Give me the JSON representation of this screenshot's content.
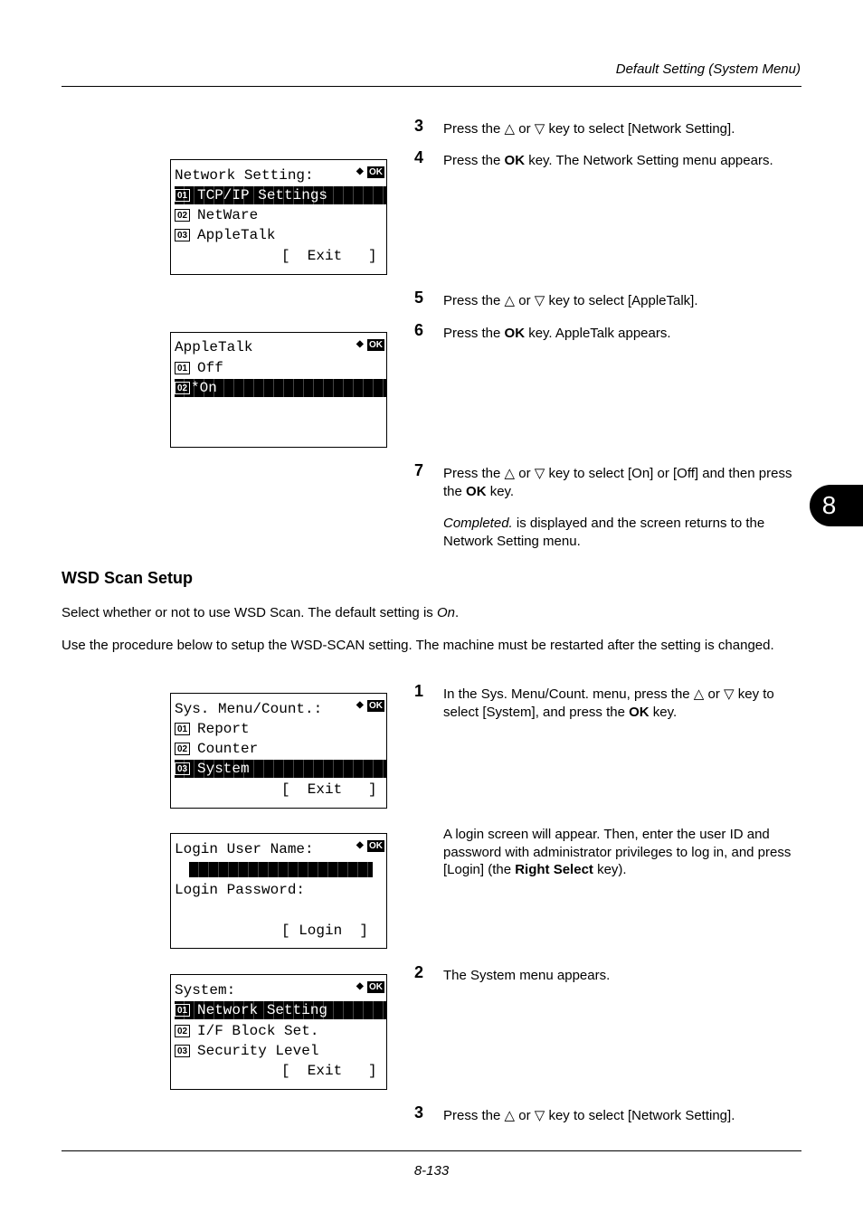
{
  "header": {
    "title": "Default Setting (System Menu)"
  },
  "chapter_tab": "8",
  "footer": {
    "page_number": "8-133"
  },
  "steps_top": [
    {
      "num": "3",
      "text": "Press the △ or ▽ key to select [Network Setting]."
    },
    {
      "num": "4",
      "text_before": "Press the ",
      "bold": "OK",
      "text_after": " key. The Network Setting menu appears."
    },
    {
      "num": "5",
      "text": "Press the △ or ▽ key to select [AppleTalk]."
    },
    {
      "num": "6",
      "text_before": "Press the ",
      "bold": "OK",
      "text_after": " key. AppleTalk appears."
    },
    {
      "num": "7",
      "text_before": "Press the △ or ▽ key to select [On] or [Off] and then press the ",
      "bold": "OK",
      "text_after": " key.",
      "note_italic": "Completed.",
      "note_rest": " is displayed and the screen returns to the Network Setting menu."
    }
  ],
  "section": {
    "title": "WSD Scan Setup",
    "intro_before": "Select whether or not to use WSD Scan. The default setting is ",
    "intro_italic": "On",
    "intro_after": ".",
    "procedure": "Use the procedure below to setup the WSD-SCAN setting. The machine must be restarted after the setting is changed."
  },
  "steps_bottom": [
    {
      "num": "1",
      "text_before": "In the Sys. Menu/Count. menu, press the △ or ▽ key to select [System], and press the ",
      "bold": "OK",
      "text_after": " key."
    },
    {
      "num": "",
      "text_before": "A login screen will appear. Then, enter the user ID and password with administrator privileges to log in, and press [Login] (the ",
      "bold": "Right Select",
      "text_after": " key)."
    },
    {
      "num": "2",
      "text": "The System menu appears."
    },
    {
      "num": "3",
      "text": "Press the △ or ▽ key to select [Network Setting]."
    }
  ],
  "icons": {
    "arrows": "◆",
    "ok": "OK"
  },
  "screens": {
    "network": {
      "title": "Network Setting:",
      "items": [
        {
          "n": "01",
          "label": "TCP/IP Settings"
        },
        {
          "n": "02",
          "label": "NetWare"
        },
        {
          "n": "03",
          "label": "AppleTalk"
        }
      ],
      "softkey": "[  Exit   ]"
    },
    "appletalk": {
      "title": "AppleTalk",
      "items": [
        {
          "n": "01",
          "label": "Off"
        },
        {
          "n": "02",
          "label": "*On"
        }
      ]
    },
    "sysmenu": {
      "title": "Sys. Menu/Count.:",
      "items": [
        {
          "n": "01",
          "label": "Report"
        },
        {
          "n": "02",
          "label": "Counter"
        },
        {
          "n": "03",
          "label": "System"
        }
      ],
      "softkey": "[  Exit   ]"
    },
    "login": {
      "title": "Login User Name:",
      "label2": "Login Password:",
      "softkey": "[ Login  ]"
    },
    "system": {
      "title": "System:",
      "items": [
        {
          "n": "01",
          "label": "Network Setting"
        },
        {
          "n": "02",
          "label": "I/F Block Set."
        },
        {
          "n": "03",
          "label": "Security Level"
        }
      ],
      "softkey": "[  Exit   ]"
    }
  }
}
